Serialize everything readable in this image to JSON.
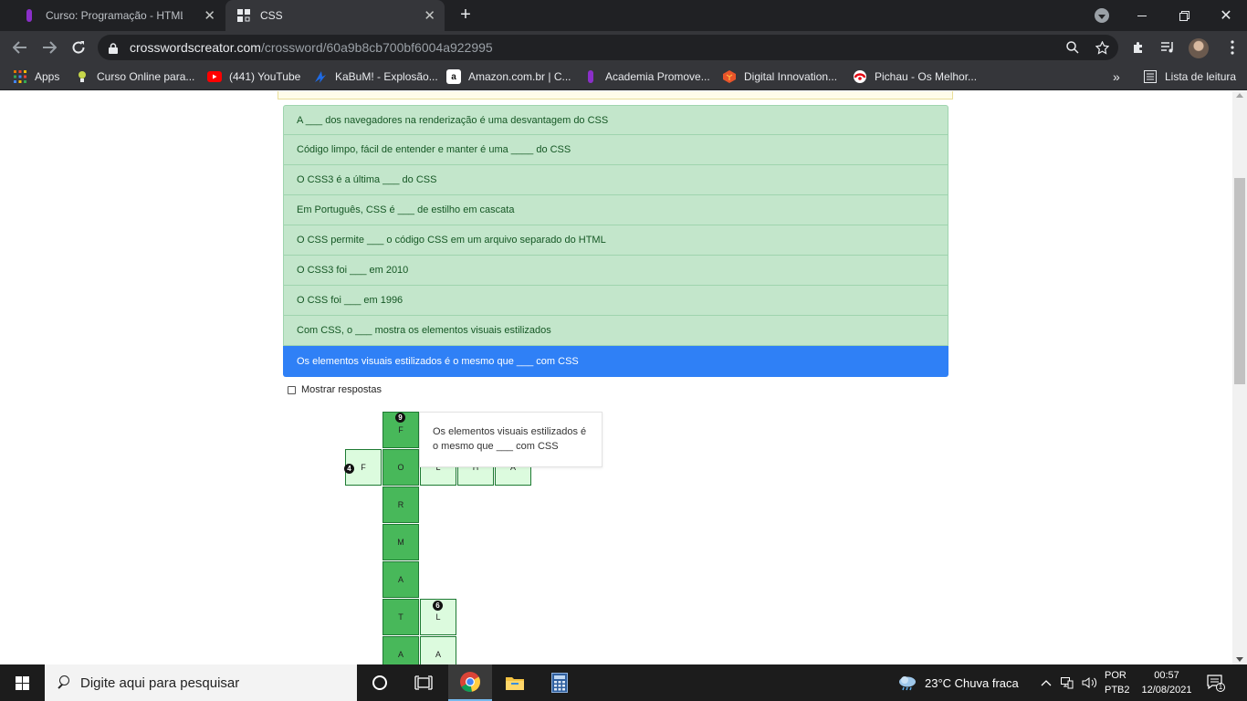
{
  "browser": {
    "tabs": [
      {
        "title": "Curso: Programação - HTML e CSS",
        "active": false,
        "favicon": "dio-logo-icon"
      },
      {
        "title": "CSS",
        "active": true,
        "favicon": "crossword-grid-icon"
      }
    ],
    "address": {
      "domain": "crosswordscreator.com",
      "path": "/crossword/60a9b8cb700bf6004a922995"
    },
    "bookmarks": [
      {
        "label": "Apps",
        "icon": "apps-grid-icon"
      },
      {
        "label": "Curso Online para...",
        "icon": "bulb-icon"
      },
      {
        "label": "(441) YouTube",
        "icon": "youtube-icon"
      },
      {
        "label": "KaBuM! - Explosão...",
        "icon": "kabum-icon"
      },
      {
        "label": "Amazon.com.br | C...",
        "icon": "amazon-icon"
      },
      {
        "label": "Academia Promove...",
        "icon": "academia-icon"
      },
      {
        "label": "Digital Innovation...",
        "icon": "dio-icon"
      },
      {
        "label": "Pichau - Os Melhor...",
        "icon": "pichau-icon"
      }
    ],
    "reading_list": "Lista de leitura"
  },
  "clues": [
    "A ___ dos navegadores na renderização é uma desvantagem do CSS",
    "Código limpo, fácil de entender e manter é uma ____ do CSS",
    "O CSS3 é a última ___ do CSS",
    "Em Português, CSS é ___ de estilho em cascata",
    "O CSS permite ___ o código CSS em um arquivo separado do HTML",
    "O CSS3 foi ___ em 2010",
    "O CSS foi ___ em 1996",
    "Com CSS, o ___ mostra os elementos visuais estilizados",
    "Os elementos visuais estilizados é o mesmo que ___ com CSS"
  ],
  "show_answers_label": "Mostrar respostas",
  "crossword": {
    "numbers": {
      "n9": "9",
      "n4": "4",
      "n6": "6"
    },
    "letters": {
      "c1": "F",
      "c2": "F",
      "c3": "O",
      "c4": "L",
      "c5": "H",
      "c6": "A",
      "c7": "R",
      "c8": "M",
      "c9": "A",
      "c10": "T",
      "c11": "L",
      "c12": "A",
      "c13": "A"
    }
  },
  "tooltip_text": "Os elementos visuais estilizados é o mesmo que ___ com CSS",
  "taskbar": {
    "search_placeholder": "Digite aqui para pesquisar",
    "weather": "23°C  Chuva fraca",
    "lang_1": "POR",
    "lang_2": "PTB2",
    "time": "00:57",
    "date": "12/08/2021",
    "notifications": "1"
  }
}
